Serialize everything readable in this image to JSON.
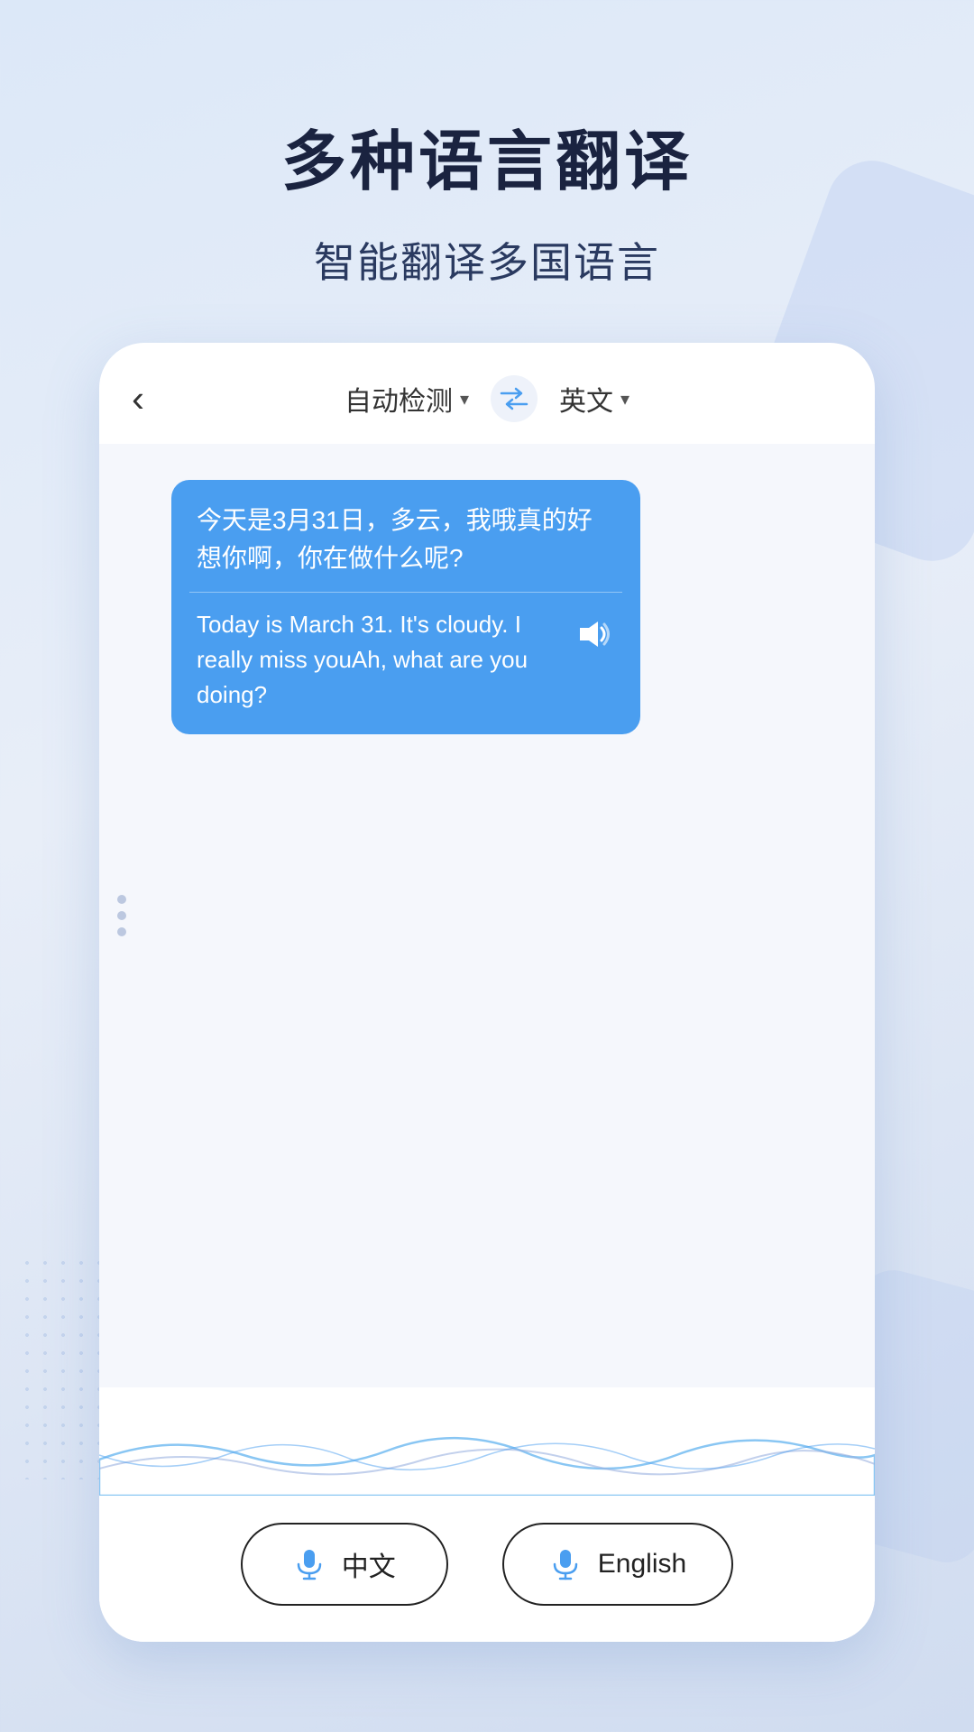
{
  "page": {
    "background": "#dce8f8"
  },
  "header": {
    "main_title": "多种语言翻译",
    "sub_title": "智能翻译多国语言"
  },
  "translator": {
    "back_label": "‹",
    "source_lang": "自动检测",
    "target_lang": "英文",
    "source_arrow": "▾",
    "target_arrow": "▾",
    "original_text": "今天是3月31日，多云，我哦真的好想你啊，你在做什么呢?",
    "translated_text": "Today is March 31. It's cloudy. I really miss youAh, what are you doing?",
    "swap_icon": "⇄"
  },
  "buttons": {
    "chinese_label": "中文",
    "english_label": "English"
  }
}
